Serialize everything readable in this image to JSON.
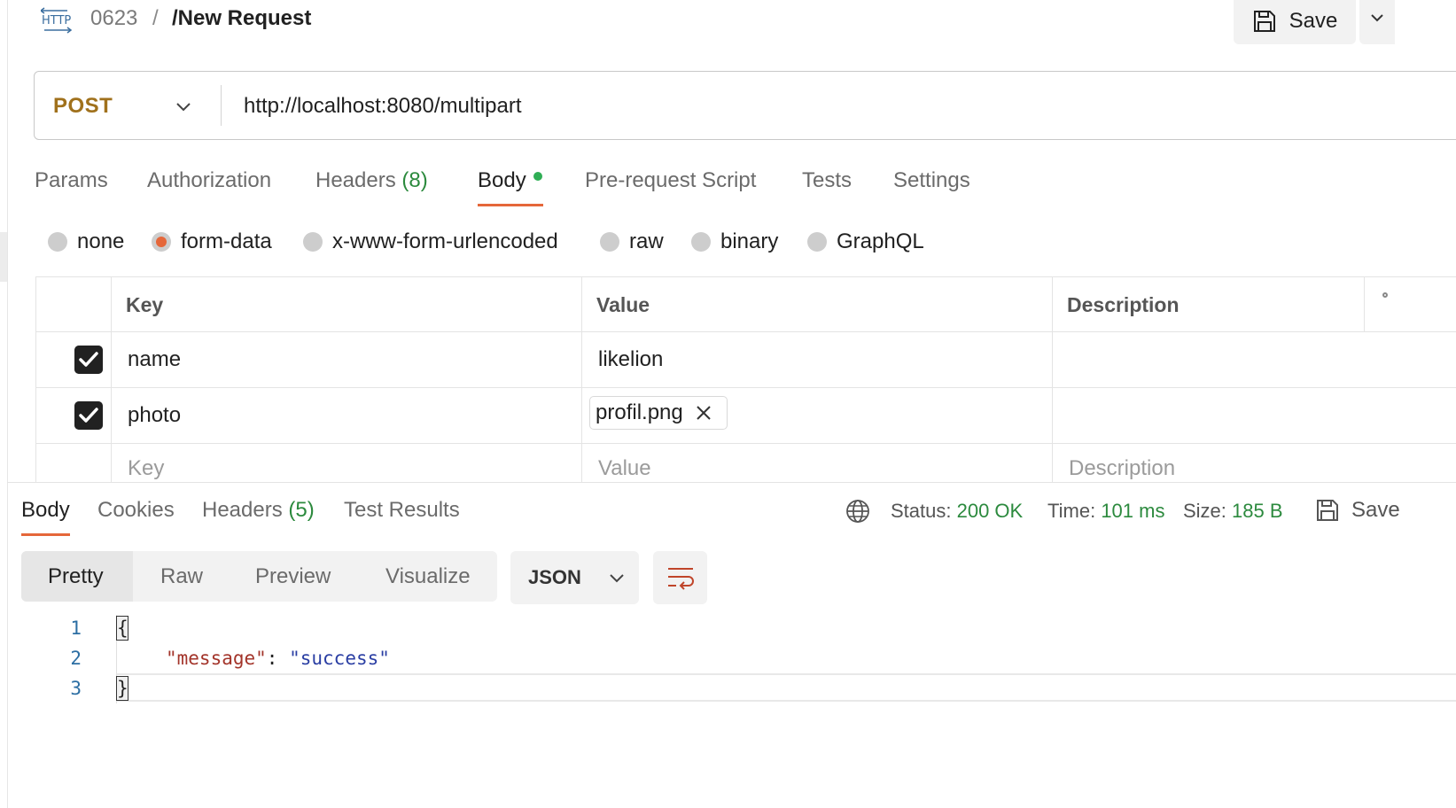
{
  "header": {
    "collection": "0623",
    "separator": "/",
    "title": "/New Request",
    "save_label": "Save"
  },
  "request": {
    "method": "POST",
    "url": "http://localhost:8080/multipart"
  },
  "request_tabs": {
    "params": "Params",
    "authorization": "Authorization",
    "headers": "Headers",
    "headers_count": "(8)",
    "body": "Body",
    "prerequest": "Pre-request Script",
    "tests": "Tests",
    "settings": "Settings"
  },
  "body_types": {
    "none": "none",
    "form_data": "form-data",
    "urlencoded": "x-www-form-urlencoded",
    "raw": "raw",
    "binary": "binary",
    "graphql": "GraphQL",
    "selected": "form-data"
  },
  "form_table": {
    "headers": {
      "key": "Key",
      "value": "Value",
      "description": "Description"
    },
    "rows": [
      {
        "checked": true,
        "key": "name",
        "value": "likelion",
        "description": ""
      },
      {
        "checked": true,
        "key": "photo",
        "file": "profil.png",
        "description": ""
      }
    ],
    "placeholder": {
      "key": "Key",
      "value": "Value",
      "description": "Description"
    }
  },
  "response": {
    "tabs": {
      "body": "Body",
      "cookies": "Cookies",
      "headers": "Headers",
      "headers_count": "(5)",
      "test_results": "Test Results"
    },
    "status_label": "Status:",
    "status_value": "200 OK",
    "time_label": "Time:",
    "time_value": "101 ms",
    "size_label": "Size:",
    "size_value": "185 B",
    "save_label": "Save",
    "view_tabs": {
      "pretty": "Pretty",
      "raw": "Raw",
      "preview": "Preview",
      "visualize": "Visualize"
    },
    "format": "JSON",
    "code": {
      "line_numbers": [
        "1",
        "2",
        "3"
      ],
      "open": "{",
      "key": "\"message\"",
      "colon": ":",
      "value": "\"success\"",
      "close": "}"
    }
  },
  "colors": {
    "accent": "#e5673a",
    "method_post": "#a0711c",
    "success_green": "#2c8a3e"
  }
}
